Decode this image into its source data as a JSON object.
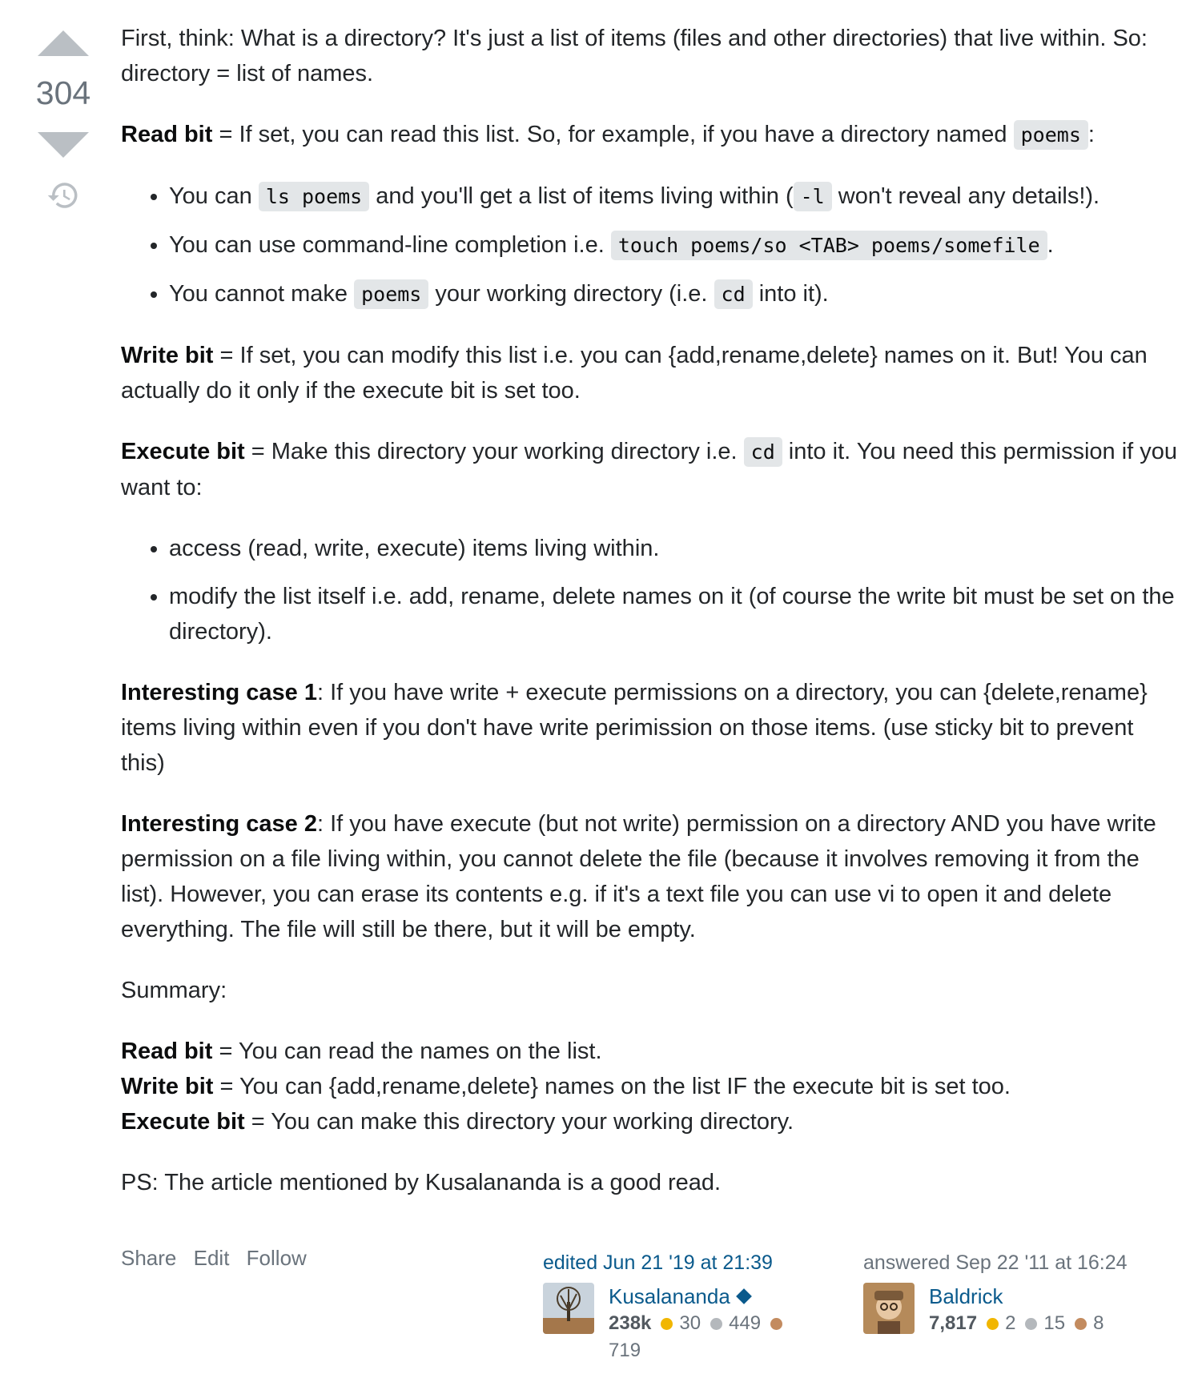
{
  "vote": {
    "count": "304"
  },
  "post": {
    "p1": "First, think: What is a directory? It's just a list of items (files and other directories) that live within. So: directory = list of names.",
    "read_label": "Read bit",
    "read_text_a": " = If set, you can read this list. So, for example, if you have a directory named ",
    "code_poems": "poems",
    "read_text_b": ":",
    "li1_a": "You can ",
    "code_ls": "ls poems",
    "li1_b": " and you'll get a list of items living within (",
    "code_l": "-l",
    "li1_c": " won't reveal any details!).",
    "li2_a": "You can use command-line completion i.e. ",
    "code_touch": "touch poems/so <TAB> poems/somefile",
    "li2_b": ".",
    "li3_a": "You cannot make ",
    "li3_b": " your working directory (i.e. ",
    "code_cd": "cd",
    "li3_c": " into it).",
    "write_label": "Write bit",
    "write_text": " = If set, you can modify this list i.e. you can {add,rename,delete} names on it. But! You can actually do it only if the execute bit is set too.",
    "exec_label": "Execute bit",
    "exec_text_a": " = Make this directory your working directory i.e. ",
    "exec_text_b": " into it. You need this permission if you want to:",
    "li4": "access (read, write, execute) items living within.",
    "li5": "modify the list itself i.e. add, rename, delete names on it (of course the write bit must be set on the directory).",
    "case1_label": "Interesting case 1",
    "case1_text": ": If you have write + execute permissions on a directory, you can {delete,rename} items living within even if you don't have write perimission on those items. (use sticky bit to prevent this)",
    "case2_label": "Interesting case 2",
    "case2_text": ": If you have execute (but not write) permission on a directory AND you have write permission on a file living within, you cannot delete the file (because it involves removing it from the list). However, you can erase its contents e.g. if it's a text file you can use vi to open it and delete everything. The file will still be there, but it will be empty.",
    "summary": "Summary:",
    "sum_read": " = You can read the names on the list.",
    "sum_write": " = You can {add,rename,delete} names on the list IF the execute bit is set too.",
    "sum_exec": " = You can make this directory your working directory.",
    "ps": "PS: The article mentioned by Kusalananda is a good read."
  },
  "actions": {
    "share": "Share",
    "edit": "Edit",
    "follow": "Follow"
  },
  "editor": {
    "when": "edited Jun 21 '19 at 21:39",
    "name": "Kusalananda",
    "rep": "238k",
    "gold": "30",
    "silver": "449",
    "bronze": "719"
  },
  "author": {
    "when": "answered Sep 22 '11 at 16:24",
    "name": "Baldrick",
    "rep": "7,817",
    "gold": "2",
    "silver": "15",
    "bronze": "8"
  },
  "colors": {
    "gold": "#f1b600",
    "silver": "#b4b8bc",
    "bronze": "#c38b5f",
    "link": "#0a5a8c"
  }
}
